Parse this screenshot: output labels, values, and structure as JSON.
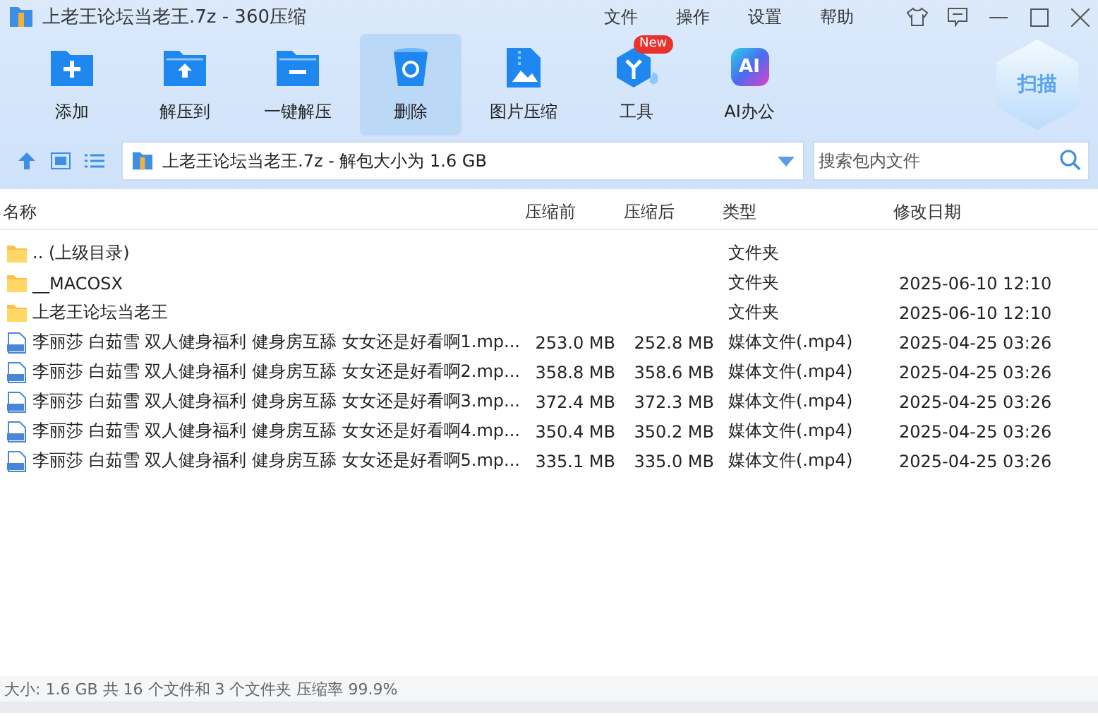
{
  "window": {
    "title": "上老王论坛当老王.7z - 360压缩"
  },
  "menu": [
    "文件",
    "操作",
    "设置",
    "帮助"
  ],
  "toolbar": [
    {
      "label": "添加",
      "kind": "add",
      "selected": false
    },
    {
      "label": "解压到",
      "kind": "extract",
      "selected": false
    },
    {
      "label": "一键解压",
      "kind": "quick",
      "selected": false
    },
    {
      "label": "删除",
      "kind": "delete",
      "selected": true
    },
    {
      "label": "图片压缩",
      "kind": "image",
      "selected": false
    },
    {
      "label": "工具",
      "kind": "tools",
      "selected": false,
      "badge": "New"
    },
    {
      "label": "AI办公",
      "kind": "ai",
      "selected": false,
      "glyph": "AI"
    }
  ],
  "scan_button": "扫描",
  "address": {
    "value": "上老王论坛当老王.7z - 解包大小为 1.6 GB"
  },
  "search": {
    "placeholder": "搜索包内文件"
  },
  "table": {
    "columns": [
      "名称",
      "压缩前",
      "压缩后",
      "类型",
      "修改日期"
    ],
    "rows": [
      {
        "kind": "folder",
        "name": ".. (上级目录)",
        "original": "",
        "packed": "",
        "type": "文件夹",
        "modified": ""
      },
      {
        "kind": "folder",
        "name": "__MACOSX",
        "original": "",
        "packed": "",
        "type": "文件夹",
        "modified": "2025-06-10 12:10"
      },
      {
        "kind": "folder",
        "name": "上老王论坛当老王",
        "original": "",
        "packed": "",
        "type": "文件夹",
        "modified": "2025-06-10 12:10"
      },
      {
        "kind": "video",
        "name": "李丽莎 白茹雪 双人健身福利 健身房互舔 女女还是好看啊1.mp...",
        "original": "253.0 MB",
        "packed": "252.8 MB",
        "type": "媒体文件(.mp4)",
        "modified": "2025-04-25 03:26"
      },
      {
        "kind": "video",
        "name": "李丽莎 白茹雪 双人健身福利 健身房互舔 女女还是好看啊2.mp...",
        "original": "358.8 MB",
        "packed": "358.6 MB",
        "type": "媒体文件(.mp4)",
        "modified": "2025-04-25 03:26"
      },
      {
        "kind": "video",
        "name": "李丽莎 白茹雪 双人健身福利 健身房互舔 女女还是好看啊3.mp...",
        "original": "372.4 MB",
        "packed": "372.3 MB",
        "type": "媒体文件(.mp4)",
        "modified": "2025-04-25 03:26"
      },
      {
        "kind": "video",
        "name": "李丽莎 白茹雪 双人健身福利 健身房互舔 女女还是好看啊4.mp...",
        "original": "350.4 MB",
        "packed": "350.2 MB",
        "type": "媒体文件(.mp4)",
        "modified": "2025-04-25 03:26"
      },
      {
        "kind": "video",
        "name": "李丽莎 白茹雪 双人健身福利 健身房互舔 女女还是好看啊5.mp...",
        "original": "335.1 MB",
        "packed": "335.0 MB",
        "type": "媒体文件(.mp4)",
        "modified": "2025-04-25 03:26"
      }
    ]
  },
  "status_bar": "大小: 1.6 GB 共 16 个文件和 3 个文件夹 压缩率 99.9%"
}
